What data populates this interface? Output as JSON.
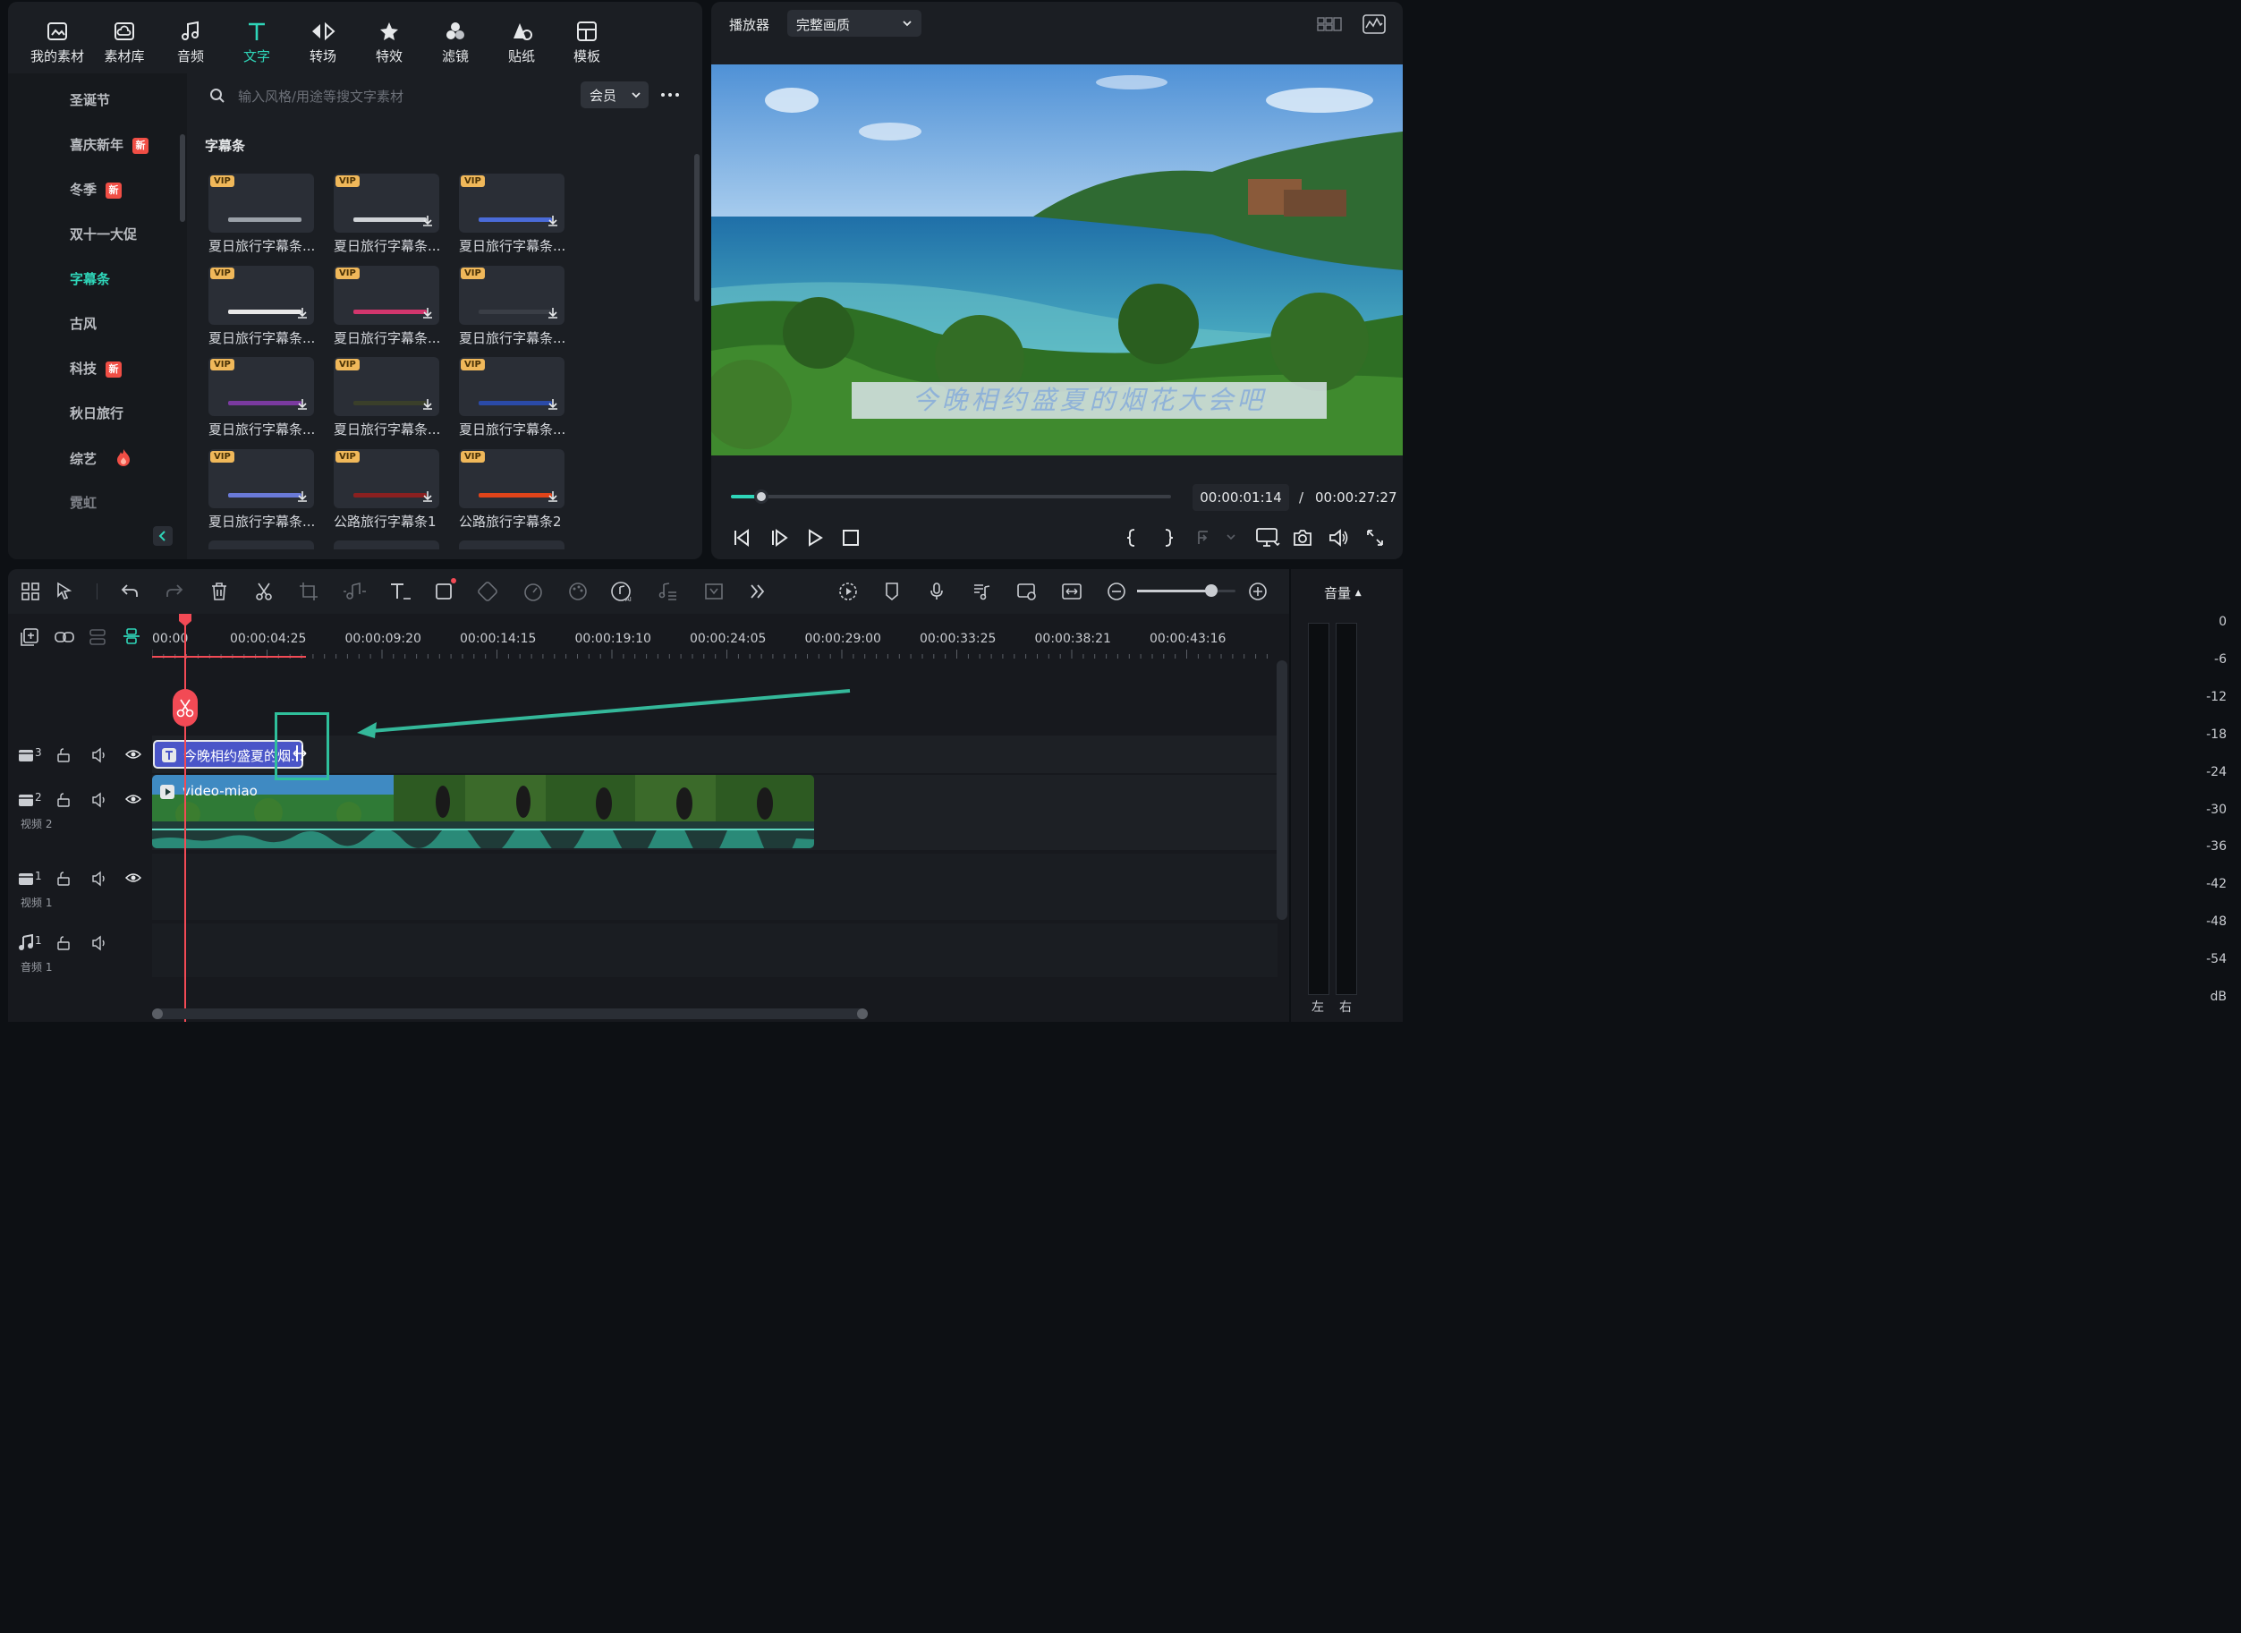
{
  "toolbar": {
    "items": [
      {
        "label": "我的素材",
        "icon": "my-media-icon"
      },
      {
        "label": "素材库",
        "icon": "cloud-library-icon"
      },
      {
        "label": "音频",
        "icon": "music-note-icon"
      },
      {
        "label": "文字",
        "icon": "text-t-icon",
        "active": true
      },
      {
        "label": "转场",
        "icon": "transition-icon"
      },
      {
        "label": "特效",
        "icon": "effects-star-icon"
      },
      {
        "label": "滤镜",
        "icon": "filter-icon"
      },
      {
        "label": "贴纸",
        "icon": "sticker-icon"
      },
      {
        "label": "模板",
        "icon": "template-icon"
      }
    ]
  },
  "categories": [
    {
      "label": "圣诞节"
    },
    {
      "label": "喜庆新年",
      "badge": "新"
    },
    {
      "label": "冬季",
      "badge": "新"
    },
    {
      "label": "双十一大促"
    },
    {
      "label": "字幕条",
      "active": true
    },
    {
      "label": "古风"
    },
    {
      "label": "科技",
      "badge": "新"
    },
    {
      "label": "秋日旅行"
    },
    {
      "label": "综艺",
      "icon": "fire-icon"
    },
    {
      "label": "霓虹"
    }
  ],
  "search": {
    "placeholder": "输入风格/用途等搜文字素材",
    "filter": "会员"
  },
  "section_title": "字幕条",
  "vip_label": "VIP",
  "cards": [
    {
      "label": "夏日旅行字幕条...",
      "download": false,
      "bar_color": "#9aa0a8"
    },
    {
      "label": "夏日旅行字幕条...",
      "download": true,
      "bar_color": "#cfd2d6"
    },
    {
      "label": "夏日旅行字幕条...",
      "download": true,
      "bar_color": "#4a6bd8"
    },
    {
      "label": "夏日旅行字幕条...",
      "download": true,
      "bar_color": "#e8e8e8"
    },
    {
      "label": "夏日旅行字幕条...",
      "download": true,
      "bar_color": "#d2366d"
    },
    {
      "label": "夏日旅行字幕条...",
      "download": true,
      "bar_color": "#3a3e46"
    },
    {
      "label": "夏日旅行字幕条...",
      "download": true,
      "bar_color": "#7a3aa0"
    },
    {
      "label": "夏日旅行字幕条...",
      "download": true,
      "bar_color": "#3a3f2a"
    },
    {
      "label": "夏日旅行字幕条...",
      "download": true,
      "bar_color": "#2a4aa8"
    },
    {
      "label": "夏日旅行字幕条...",
      "download": true,
      "bar_color": "#6a7ad8"
    },
    {
      "label": "公路旅行字幕条1",
      "download": true,
      "bar_color": "#8a2020"
    },
    {
      "label": "公路旅行字幕条2",
      "download": true,
      "bar_color": "#e0441a"
    }
  ],
  "player": {
    "title": "播放器",
    "quality": "完整画质",
    "overlay_text": "今晚相约盛夏的烟花大会吧",
    "current_time": "00:00:01:14",
    "separator": "/",
    "total_time": "00:00:27:27",
    "progress": 0.07
  },
  "timeline": {
    "ruler": [
      "00:00",
      "00:00:04:25",
      "00:00:09:20",
      "00:00:14:15",
      "00:00:19:10",
      "00:00:24:05",
      "00:00:29:00",
      "00:00:33:25",
      "00:00:38:21",
      "00:00:43:16"
    ],
    "zoom": 0.75,
    "tracks": [
      {
        "num": "3",
        "name": ""
      },
      {
        "num": "2",
        "name": "视频 2"
      },
      {
        "num": "1",
        "name": "视频 1"
      },
      {
        "num": "1",
        "name": "音频 1"
      }
    ],
    "text_clip": "今晚相约盛夏的烟...",
    "video_clip": "video-miao"
  },
  "meter": {
    "title": "音量",
    "scale": [
      "0",
      "-6",
      "-12",
      "-18",
      "-24",
      "-30",
      "-36",
      "-42",
      "-48",
      "-54",
      "dB"
    ],
    "left": "左",
    "right": "右"
  },
  "colors": {
    "accent": "#2fd6b9",
    "playhead": "#f24a55",
    "text_clip": "#4a55c8",
    "vip": "#f0b85a"
  }
}
